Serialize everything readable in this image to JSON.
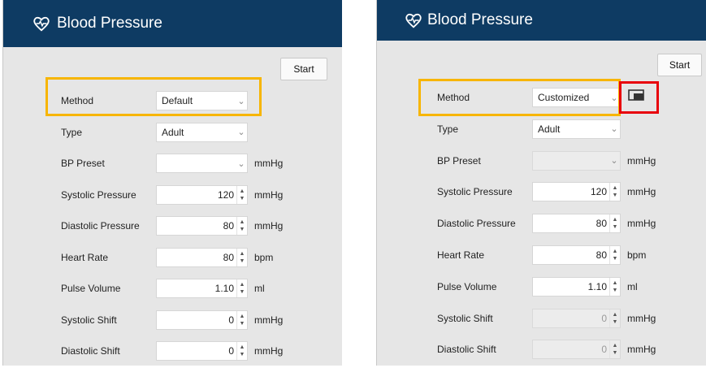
{
  "left": {
    "title": "Blood Pressure",
    "start_label": "Start",
    "rows": [
      {
        "label": "Method",
        "value": "Default",
        "kind": "select"
      },
      {
        "label": "Type",
        "value": "Adult",
        "kind": "select"
      },
      {
        "label": "BP Preset",
        "value": "",
        "kind": "select",
        "unit": "mmHg"
      },
      {
        "label": "Systolic Pressure",
        "value": "120",
        "kind": "spin",
        "unit": "mmHg"
      },
      {
        "label": "Diastolic Pressure",
        "value": "80",
        "kind": "spin",
        "unit": "mmHg"
      },
      {
        "label": "Heart Rate",
        "value": "80",
        "kind": "spin",
        "unit": "bpm"
      },
      {
        "label": "Pulse Volume",
        "value": "1.10",
        "kind": "spin",
        "unit": "ml"
      },
      {
        "label": "Systolic Shift",
        "value": "0",
        "kind": "spin",
        "unit": "mmHg"
      },
      {
        "label": "Diastolic Shift",
        "value": "0",
        "kind": "spin",
        "unit": "mmHg"
      }
    ]
  },
  "right": {
    "title": "Blood Pressure",
    "start_label": "Start",
    "rows": [
      {
        "label": "Method",
        "value": "Customized",
        "kind": "select"
      },
      {
        "label": "Type",
        "value": "Adult",
        "kind": "select"
      },
      {
        "label": "BP Preset",
        "value": "",
        "kind": "select",
        "unit": "mmHg",
        "disabled": true
      },
      {
        "label": "Systolic Pressure",
        "value": "120",
        "kind": "spin",
        "unit": "mmHg"
      },
      {
        "label": "Diastolic Pressure",
        "value": "80",
        "kind": "spin",
        "unit": "mmHg"
      },
      {
        "label": "Heart Rate",
        "value": "80",
        "kind": "spin",
        "unit": "bpm"
      },
      {
        "label": "Pulse Volume",
        "value": "1.10",
        "kind": "spin",
        "unit": "ml"
      },
      {
        "label": "Systolic Shift",
        "value": "0",
        "kind": "spin",
        "unit": "mmHg",
        "disabled": true
      },
      {
        "label": "Diastolic Shift",
        "value": "0",
        "kind": "spin",
        "unit": "mmHg",
        "disabled": true
      }
    ]
  },
  "icons": {
    "header": "heart-pulse-icon",
    "customize": "edit-panel-icon"
  },
  "colors": {
    "header_bg": "#0e3b63",
    "highlight_orange": "#f7b500",
    "highlight_red": "#e8000b"
  }
}
